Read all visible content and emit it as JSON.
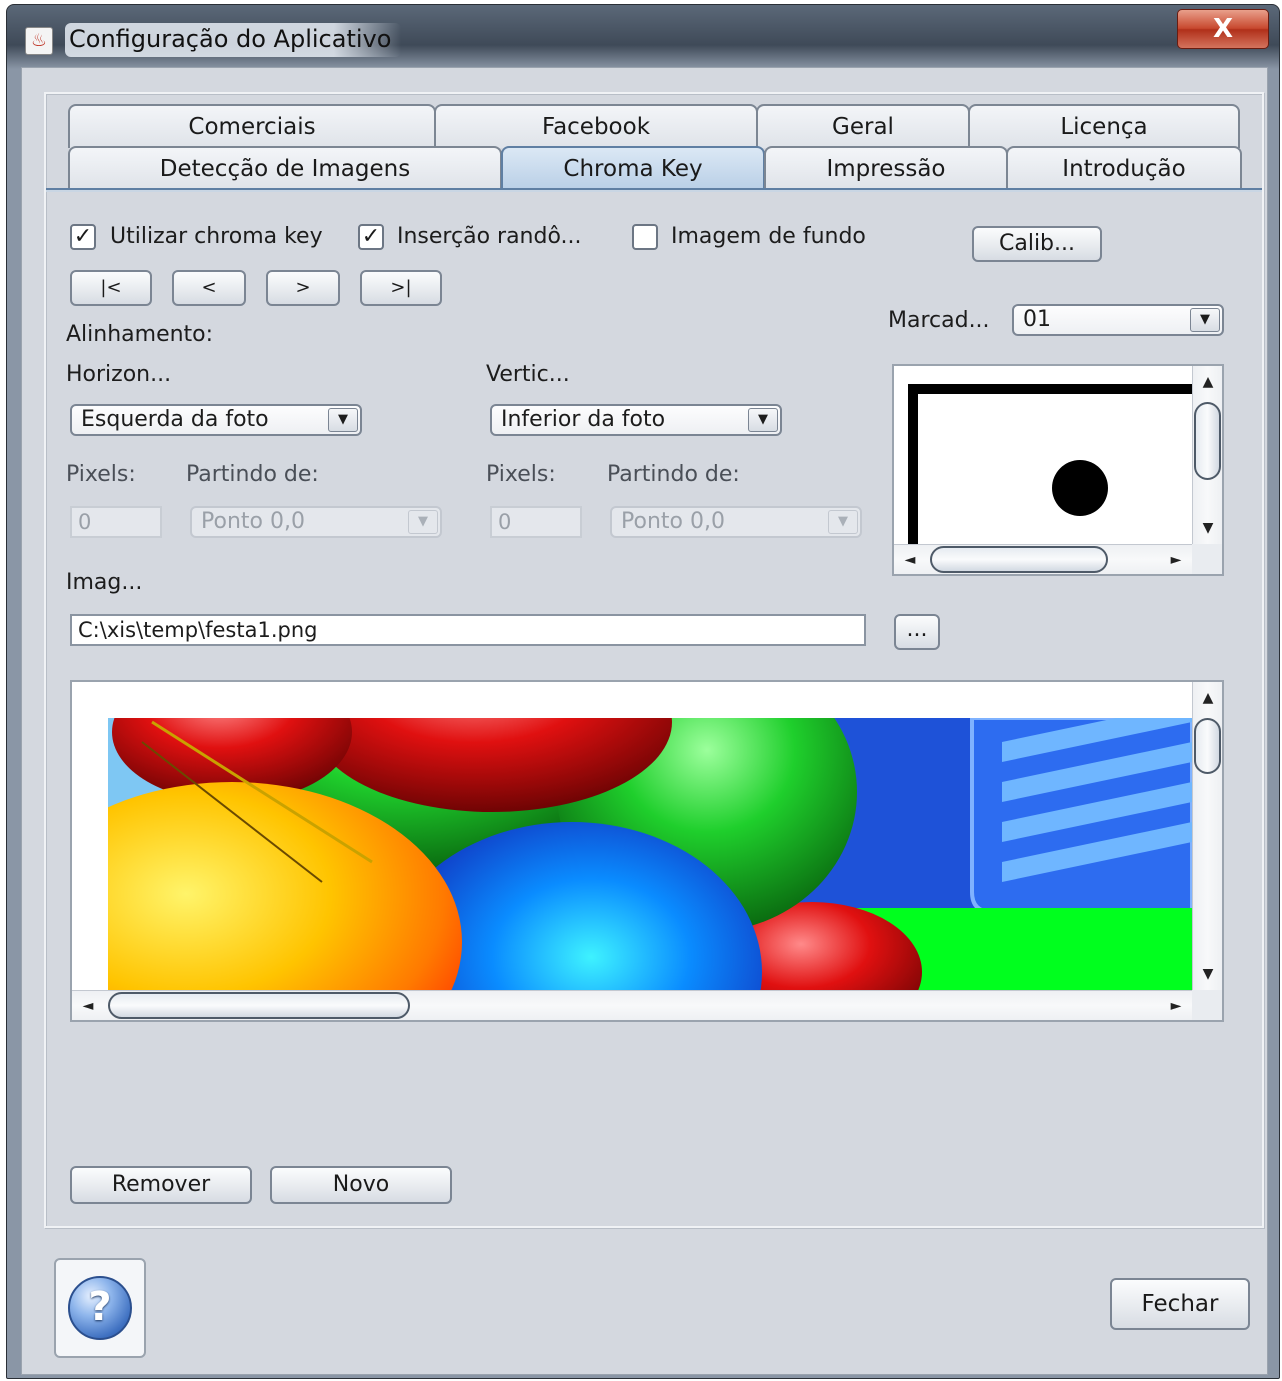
{
  "window": {
    "title": "Configuração do Aplicativo",
    "close_glyph": "X"
  },
  "tabs_row1": [
    "Comerciais",
    "Facebook",
    "Geral",
    "Licença"
  ],
  "tabs_row2": [
    "Detecção de Imagens",
    "Chroma Key",
    "Impressão",
    "Introdução"
  ],
  "active_tab": "Chroma Key",
  "options": {
    "use_chroma_key": {
      "label": "Utilizar chroma key",
      "checked": true
    },
    "random_insert": {
      "label": "Inserção randô...",
      "checked": true
    },
    "background_image": {
      "label": "Imagem de fundo",
      "checked": false
    },
    "calib_label": "Calib..."
  },
  "nav": {
    "first": "|<",
    "prev": "<",
    "next": ">",
    "last": ">|"
  },
  "marker": {
    "label": "Marcad...",
    "value": "01"
  },
  "alignment": {
    "label": "Alinhamento:",
    "horizontal": {
      "label": "Horizon...",
      "value": "Esquerda da foto",
      "pixels_label": "Pixels:",
      "pixels_value": "0",
      "from_label": "Partindo de:",
      "from_value": "Ponto 0,0"
    },
    "vertical": {
      "label": "Vertic...",
      "value": "Inferior da foto",
      "pixels_label": "Pixels:",
      "pixels_value": "0",
      "from_label": "Partindo de:",
      "from_value": "Ponto 0,0"
    }
  },
  "image": {
    "label": "Imag...",
    "path": "C:\\xis\\temp\\festa1.png",
    "browse_label": "..."
  },
  "buttons": {
    "remove": "Remover",
    "new": "Novo",
    "close": "Fechar",
    "help": "?"
  },
  "icons": {
    "app": "java-cup-icon",
    "scroll_up": "▲",
    "scroll_down": "▼",
    "scroll_left": "◄",
    "scroll_right": "►",
    "combo": "▼"
  },
  "colors": {
    "active_tab": "#b9cfe6",
    "chroma_green": "#00ff1e",
    "close_red": "#c8492f"
  }
}
